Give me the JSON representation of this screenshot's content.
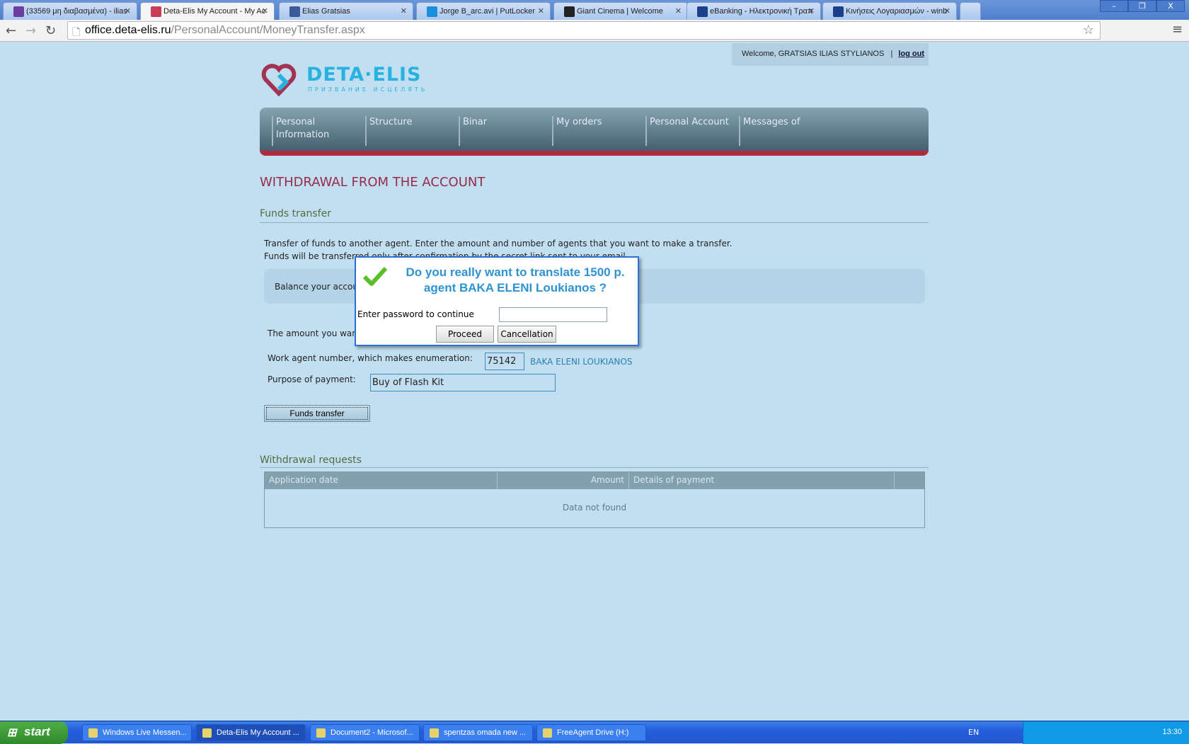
{
  "browser": {
    "tabs": [
      {
        "label": "(33569 μη διαβασμένα) - ilias",
        "icon": "mail-icon",
        "color": "#6a3fa0"
      },
      {
        "label": "Deta-Elis My Account - My Ac",
        "icon": "deta-elis-icon",
        "color": "#c83c55",
        "active": true
      },
      {
        "label": "Elias Gratsias",
        "icon": "facebook-icon",
        "color": "#3b5998"
      },
      {
        "label": "Jorge B_arc.avi | PutLocker",
        "icon": "putlocker-icon",
        "color": "#1a8fe0"
      },
      {
        "label": "Giant Cinema | Welcome",
        "icon": "giant-cinema-icon",
        "color": "#222"
      },
      {
        "label": "eBanking - Ηλεκτρονική Τραπ",
        "icon": "ebanking-icon",
        "color": "#1b3f8a"
      },
      {
        "label": "Κινήσεις Λογαριασμών - winb",
        "icon": "winbank-icon",
        "color": "#1b3f8a"
      }
    ],
    "url_host": "office.deta-elis.ru",
    "url_path": "/PersonalAccount/MoneyTransfer.aspx"
  },
  "header": {
    "welcome": "Welcome, GRATSIAS ILIAS STYLIANOS",
    "separator": "|",
    "logout": "log out",
    "logo_text": "DETA·ELIS",
    "logo_tagline": "ПРИЗВАНИЕ ИСЦЕЛЯТЬ"
  },
  "nav": [
    "Personal Information",
    "Structure",
    "Binar",
    "My orders",
    "Personal Account",
    "Messages of"
  ],
  "page": {
    "title": "WITHDRAWAL FROM THE ACCOUNT",
    "funds_heading": "Funds transfer",
    "intro_1": "Transfer of funds to another agent. Enter the amount and number of agents that you want to make a transfer.",
    "intro_2": "Funds will be transferred only after confirmation by the secret link sent to your email.",
    "balance_label": "Balance your account",
    "amount_label": "The amount you want to transfer:",
    "agent_label": "Work agent number, which makes enumeration:",
    "agent_value": "75142",
    "agent_name": "BAKA ELENI LOUKIANOS",
    "purpose_label": "Purpose of payment:",
    "purpose_value": "Buy of Flash Kit",
    "submit": "Funds transfer",
    "requests_heading": "Withdrawal requests",
    "table": {
      "columns": [
        "Application date",
        "Amount",
        "Details of payment",
        ""
      ],
      "empty": "Data not found"
    }
  },
  "dialog": {
    "title": "Do you really want to translate 1500 p. agent BAKA ELENI Loukianos ?",
    "password_label": "Enter password to continue",
    "password_value": "",
    "proceed": "Proceed",
    "cancel": "Cancellation"
  },
  "taskbar": {
    "start": "start",
    "tasks": [
      "Windows Live Messen...",
      "Deta-Elis My Account ...",
      "Document2 - Microsof...",
      "spentzas omada new ...",
      "FreeAgent Drive (H:)"
    ],
    "lang": "EN",
    "clock": "13:30"
  }
}
